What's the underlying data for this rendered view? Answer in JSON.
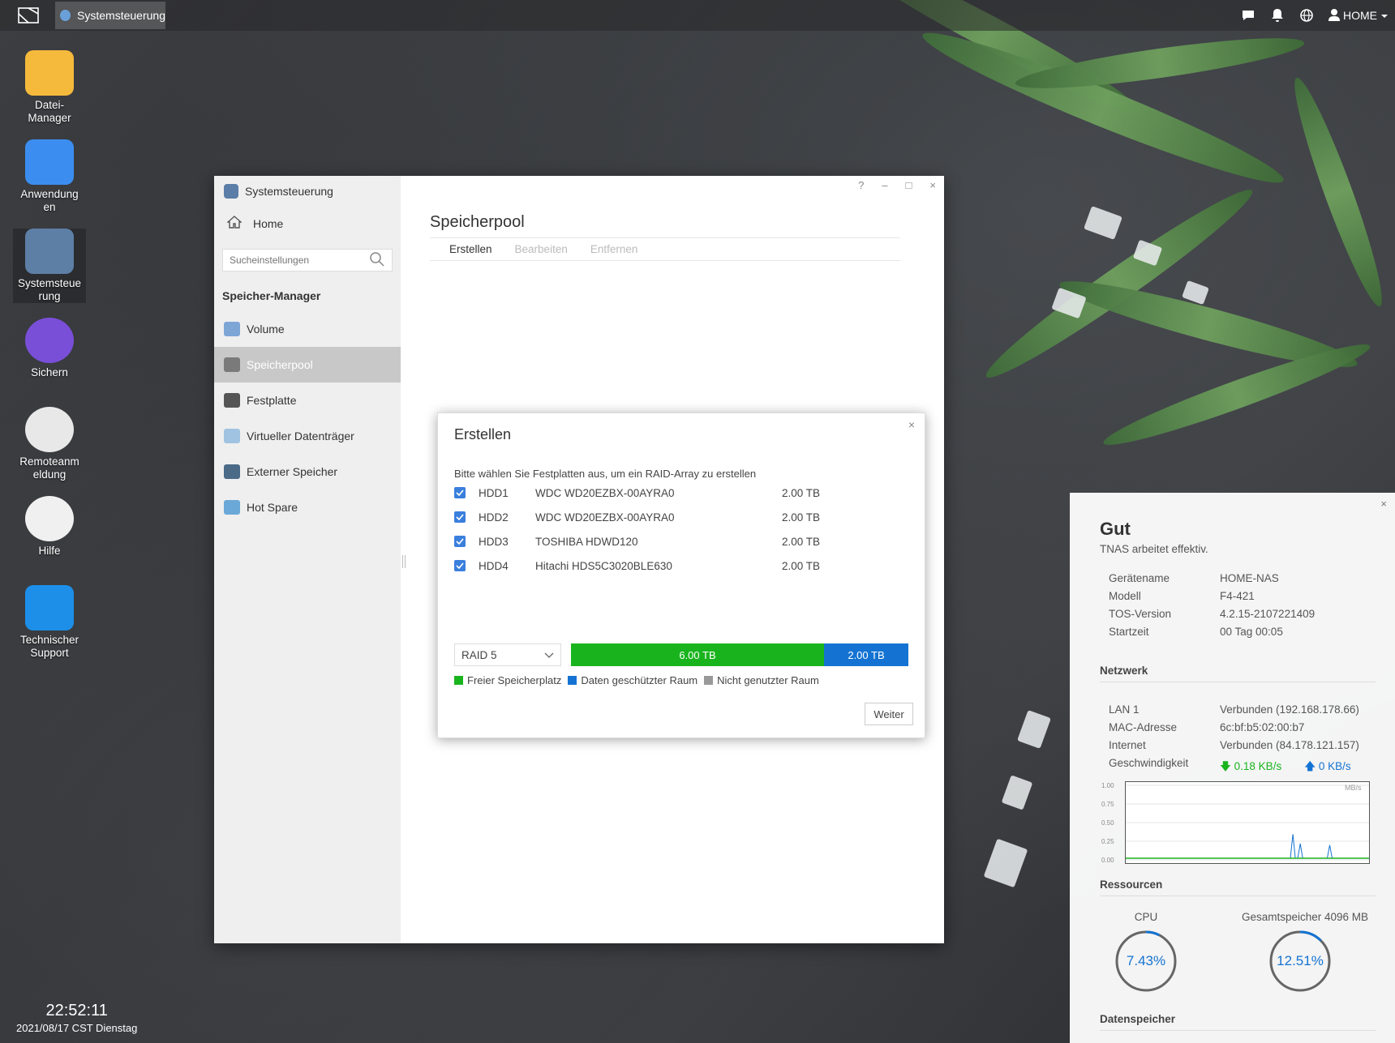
{
  "taskbar": {
    "active_task": "Systemsteuerung",
    "user": "HOME",
    "icons": [
      "chat-icon",
      "bell-icon",
      "globe-icon",
      "user-icon"
    ]
  },
  "desktop": {
    "icons": [
      {
        "label": "Datei-\nManager",
        "icon": "folder-icon",
        "color": "#f5b93c"
      },
      {
        "label": "Anwendung\nen",
        "icon": "app-store-icon",
        "color": "#3b8ef0"
      },
      {
        "label": "Systemsteue\nrung",
        "icon": "gear-icon",
        "color": "#5d7fa6"
      },
      {
        "label": "Sichern",
        "icon": "backup-clock-icon",
        "color": "#7a4fd8"
      },
      {
        "label": "Remoteanm\neldung",
        "icon": "remote-cloud-icon",
        "color": "#e8e8e8"
      },
      {
        "label": "Hilfe",
        "icon": "help-icon",
        "color": "#f0f0f0"
      },
      {
        "label": "Technischer\nSupport",
        "icon": "headset-icon",
        "color": "#1d8fe8"
      }
    ]
  },
  "clock": {
    "time": "22:52:11",
    "date": "2021/08/17 CST Dienstag"
  },
  "window": {
    "title": "Systemsteuerung",
    "controls": [
      "?",
      "–",
      "□",
      "×"
    ],
    "home": "Home",
    "search_placeholder": "Sucheinstellungen",
    "section": "Speicher-Manager",
    "nav": [
      {
        "label": "Volume",
        "icon": "volume-icon",
        "color": "#7da6d6"
      },
      {
        "label": "Speicherpool",
        "icon": "storage-pool-icon",
        "color": "#7a7a7a"
      },
      {
        "label": "Festplatte",
        "icon": "harddisk-icon",
        "color": "#555555"
      },
      {
        "label": "Virtueller Datenträger",
        "icon": "virtual-disk-icon",
        "color": "#9fc3e0"
      },
      {
        "label": "Externer Speicher",
        "icon": "external-storage-icon",
        "color": "#4a6a88"
      },
      {
        "label": "Hot Spare",
        "icon": "hot-spare-icon",
        "color": "#6aa8d8"
      }
    ],
    "content_title": "Speicherpool",
    "tabs": [
      {
        "label": "Erstellen",
        "enabled": true
      },
      {
        "label": "Bearbeiten",
        "enabled": false
      },
      {
        "label": "Entfernen",
        "enabled": false
      }
    ]
  },
  "dialog": {
    "title": "Erstellen",
    "close": "×",
    "instruction": "Bitte wählen Sie Festplatten aus, um ein RAID-Array zu erstellen",
    "disks": [
      {
        "name": "HDD1",
        "model": "WDC WD20EZBX-00AYRA0",
        "size": "2.00 TB",
        "checked": true
      },
      {
        "name": "HDD2",
        "model": "WDC WD20EZBX-00AYRA0",
        "size": "2.00 TB",
        "checked": true
      },
      {
        "name": "HDD3",
        "model": "TOSHIBA HDWD120",
        "size": "2.00 TB",
        "checked": true
      },
      {
        "name": "HDD4",
        "model": "Hitachi HDS5C3020BLE630",
        "size": "2.00 TB",
        "checked": true
      }
    ],
    "raid_level": "RAID 5",
    "free_label": "6.00 TB",
    "protected_label": "2.00 TB",
    "free_fraction": 0.75,
    "legend": [
      {
        "label": "Freier Speicherplatz",
        "color": "#19b41d"
      },
      {
        "label": "Daten geschützter Raum",
        "color": "#1473d2"
      },
      {
        "label": "Nicht genutzter Raum",
        "color": "#999999"
      }
    ],
    "next_button": "Weiter"
  },
  "status": {
    "close": "×",
    "state": "Gut",
    "subtitle": "TNAS arbeitet effektiv.",
    "device": [
      {
        "k": "Gerätename",
        "v": "HOME-NAS"
      },
      {
        "k": "Modell",
        "v": "F4-421"
      },
      {
        "k": "TOS-Version",
        "v": "4.2.15-2107221409"
      },
      {
        "k": "Startzeit",
        "v": "00 Tag 00:05"
      }
    ],
    "network_title": "Netzwerk",
    "network": [
      {
        "k": "LAN 1",
        "v": "Verbunden (192.168.178.66)"
      },
      {
        "k": "MAC-Adresse",
        "v": "6c:bf:b5:02:00:b7"
      },
      {
        "k": "Internet",
        "v": "Verbunden (84.178.121.157)"
      }
    ],
    "speed_label": "Geschwindigkeit",
    "speed_down": "0.18 KB/s",
    "speed_up": "0 KB/s",
    "graph": {
      "unit": "MB/s",
      "y_ticks": [
        "1.00",
        "0.75",
        "0.50",
        "0.25",
        "0.00"
      ],
      "ylim": [
        0,
        1.0
      ],
      "download_series": [
        0,
        0,
        0,
        0,
        0,
        0,
        0,
        0,
        0,
        0,
        0,
        0,
        0,
        0,
        0,
        0,
        0,
        0,
        0,
        0,
        0,
        0,
        0,
        0,
        0,
        0,
        0,
        0,
        0,
        0,
        0,
        0,
        0,
        0,
        0,
        0,
        0,
        0,
        0,
        0,
        0,
        0,
        0,
        0,
        0,
        0,
        0,
        0,
        0,
        0,
        0,
        0,
        0,
        0,
        0,
        0,
        0,
        0,
        0,
        0,
        0,
        0,
        0,
        0,
        0,
        0,
        0,
        0,
        0.33,
        0,
        0,
        0.2,
        0,
        0,
        0,
        0,
        0,
        0,
        0,
        0,
        0,
        0,
        0,
        0.18,
        0,
        0,
        0,
        0,
        0,
        0,
        0,
        0,
        0,
        0,
        0,
        0,
        0,
        0,
        0,
        0
      ]
    },
    "resources_title": "Ressourcen",
    "cpu_label": "CPU",
    "cpu_value": "7.43%",
    "cpu_fraction": 0.0743,
    "mem_label": "Gesamtspeicher 4096 MB",
    "mem_value": "12.51%",
    "mem_fraction": 0.1251,
    "storage_title": "Datenspeicher"
  }
}
